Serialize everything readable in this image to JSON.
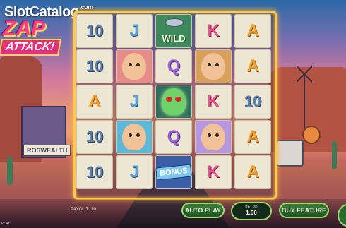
{
  "watermark": {
    "brand": "SlotCatalog",
    "suffix": ".com"
  },
  "logo": {
    "line1": "ZAP",
    "line2": "ATTACK!"
  },
  "scenery": {
    "sign": "ROSWEALTH"
  },
  "reels": [
    [
      "10",
      "J",
      "WILD",
      "K",
      "A"
    ],
    [
      "10",
      "pic-woman",
      "Q",
      "pic-sheriff",
      "A"
    ],
    [
      "A",
      "J",
      "alien",
      "K",
      "10"
    ],
    [
      "10",
      "pic-farmer",
      "Q",
      "pic-granny",
      "A"
    ],
    [
      "10",
      "J",
      "BONUS",
      "K",
      "A"
    ]
  ],
  "symbols": {
    "wild_label": "WILD",
    "bonus_label": "BONUS"
  },
  "controls": {
    "payout_text": "PAYOUT: 10",
    "auto_play": "AUTO PLAY",
    "bet_label": "BET (€)",
    "bet_value": "1.00",
    "buy_feature": "BUY FEATURE",
    "footer": "PLAY"
  }
}
